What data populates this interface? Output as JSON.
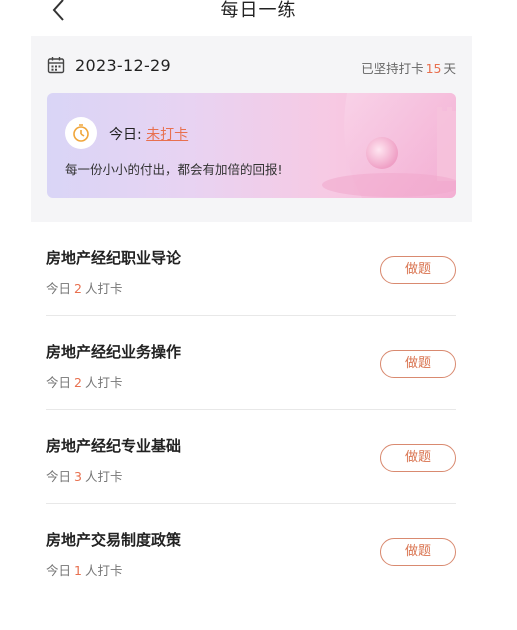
{
  "header": {
    "title": "每日一练",
    "back_icon": "chevron-left-icon"
  },
  "checkin": {
    "date": "2023-12-29",
    "calendar_icon": "calendar-icon",
    "streak_prefix": "已坚持打卡",
    "streak_days": "15",
    "streak_suffix": "天",
    "today_label": "今日:",
    "today_status": "未打卡",
    "clock_icon": "stopwatch-icon",
    "motto": "每一份小小的付出，都会有加倍的回报!"
  },
  "practice": {
    "button_label": "做题",
    "sub_prefix": "今日",
    "sub_suffix": "人打卡",
    "items": [
      {
        "title": "房地产经纪职业导论",
        "count": "2"
      },
      {
        "title": "房地产经纪业务操作",
        "count": "2"
      },
      {
        "title": "房地产经纪专业基础",
        "count": "3"
      },
      {
        "title": "房地产交易制度政策",
        "count": "1"
      }
    ]
  },
  "colors": {
    "accent": "#e8704f",
    "panel_bg": "#f5f5f7",
    "divider": "#e8e8e8"
  }
}
